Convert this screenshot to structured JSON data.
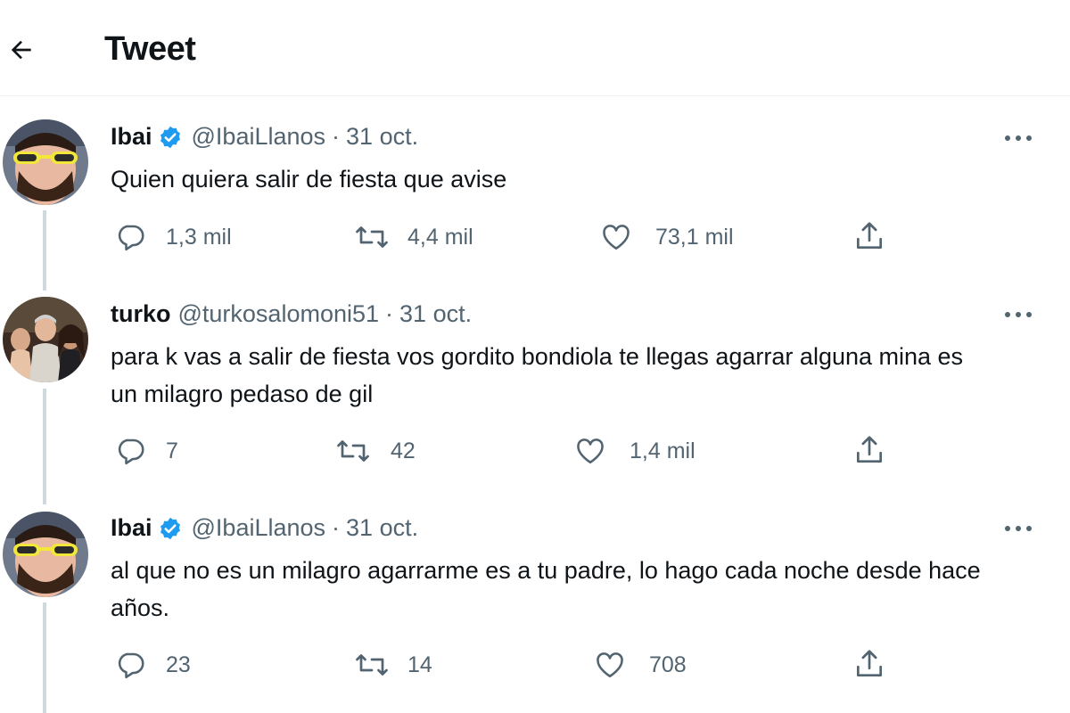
{
  "header": {
    "title": "Tweet",
    "back_icon": "arrow-left-icon"
  },
  "colors": {
    "verified": "#1d9bf0",
    "secondary_text": "#536471",
    "thread_line": "#cfd9de",
    "divider": "#eff3f4"
  },
  "tweets": [
    {
      "name": "Ibai",
      "verified": true,
      "handle": "@IbaiLlanos",
      "separator": "·",
      "date": "31 oct.",
      "text": "Quien quiera salir de fiesta que avise",
      "replies": "1,3 mil",
      "retweets": "4,4 mil",
      "likes": "73,1 mil"
    },
    {
      "name": "turko",
      "verified": false,
      "handle": "@turkosalomoni51",
      "separator": "·",
      "date": "31 oct.",
      "text": "para k vas a salir de fiesta vos gordito bondiola te llegas agarrar alguna mina es un milagro pedaso de gil",
      "replies": "7",
      "retweets": "42",
      "likes": "1,4 mil"
    },
    {
      "name": "Ibai",
      "verified": true,
      "handle": "@IbaiLlanos",
      "separator": "·",
      "date": "31 oct.",
      "text": "al que no es un milagro agarrarme es a tu padre, lo hago cada noche desde hace años.",
      "replies": "23",
      "retweets": "14",
      "likes": "708"
    }
  ]
}
